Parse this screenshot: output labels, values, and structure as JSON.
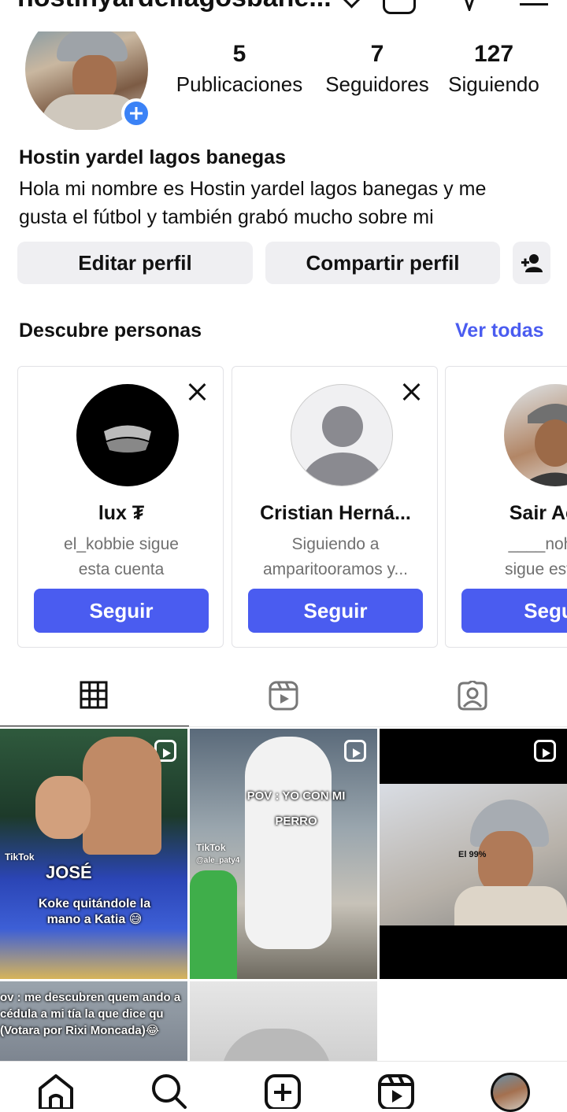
{
  "header": {
    "username": "hostinyardellagosbane..."
  },
  "profile": {
    "stats": [
      {
        "value": "5",
        "label": "Publicaciones"
      },
      {
        "value": "7",
        "label": "Seguidores"
      },
      {
        "value": "127",
        "label": "Siguiendo"
      }
    ],
    "name": "Hostin yardel lagos banegas",
    "bio_line1": "Hola mi nombre es Hostin yardel lagos banegas y me",
    "bio_line2": "gusta el fútbol y también grabó mucho sobre mi"
  },
  "actions": {
    "edit": "Editar perfil",
    "share": "Compartir perfil"
  },
  "discover": {
    "title": "Descubre personas",
    "see_all": "Ver todas",
    "cards": [
      {
        "name": "lux ₮",
        "sub1": "el_kobbie sigue",
        "sub2": "esta cuenta",
        "button": "Seguir"
      },
      {
        "name": "Cristian Herná...",
        "sub1": "Siguiendo a",
        "sub2": "amparitooramos y...",
        "button": "Seguir"
      },
      {
        "name": "Sair Aco",
        "sub1": "____noheli",
        "sub2": "sigue esta c",
        "button": "Segu"
      }
    ]
  },
  "posts": {
    "p1_caption": "Koke quitándole la mano a Katia 😅",
    "p1_shirt": "JOSÉ",
    "p1_tiktok": "TikTok",
    "p2_caption": "POV : YO CON MI PERRO",
    "p2_tiktok": "TikTok",
    "p2_handle": "@ale_paty4",
    "p3_text": "El 99%",
    "p4_caption": "ov : me descubren quem ando a cédula a mi tía la que dice qu (Votara por Rixi Moncada)😂"
  },
  "colors": {
    "accent": "#4a5cf0",
    "badge": "#3b82f6"
  }
}
